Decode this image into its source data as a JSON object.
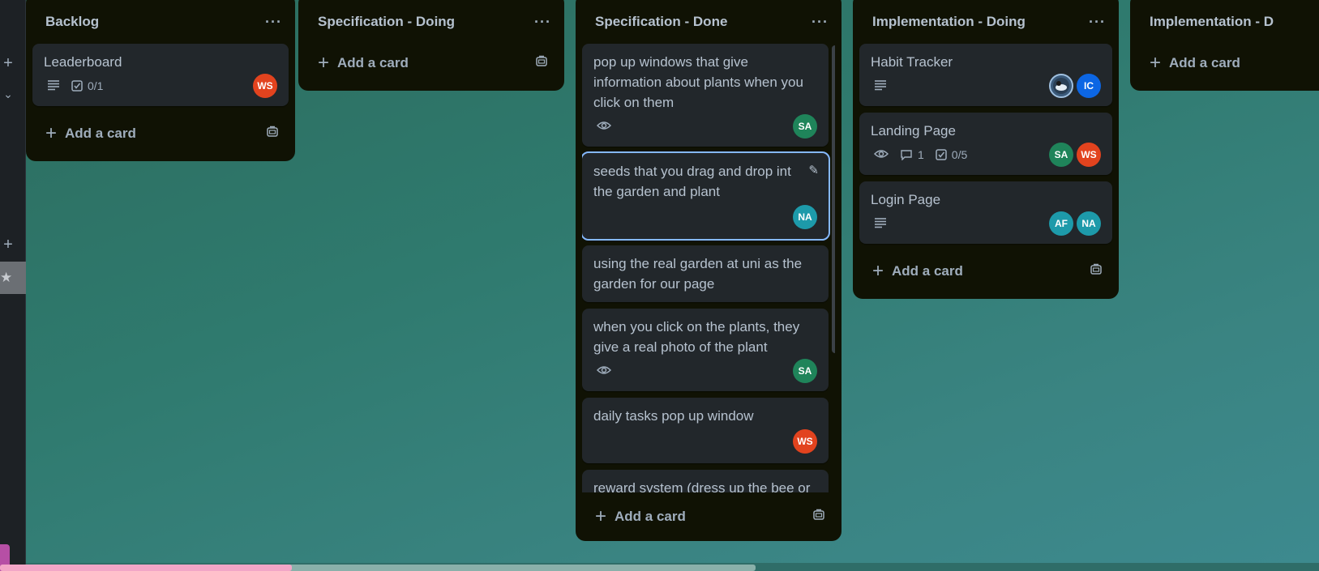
{
  "lists": [
    {
      "title": "Backlog",
      "cards": [
        {
          "title": "Leaderboard",
          "checklist": "0/1",
          "avatars": [
            {
              "initials": "WS",
              "color": "#e2431e"
            }
          ]
        }
      ],
      "add_label": "Add a card"
    },
    {
      "title": "Specification - Doing",
      "cards": [],
      "add_label": "Add a card"
    },
    {
      "title": "Specification - Done",
      "cards": [
        {
          "title": "pop up windows that give information about plants when you click on them",
          "avatars": [
            {
              "initials": "SA",
              "color": "#1f845a"
            }
          ]
        },
        {
          "title": "seeds that you drag and drop int the garden and plant",
          "avatars": [
            {
              "initials": "NA",
              "color": "#1d9aaa"
            }
          ]
        },
        {
          "title": "using the real garden at uni as the garden for our page"
        },
        {
          "title": "when you click on the plants, they give a real photo of the plant",
          "avatars": [
            {
              "initials": "SA",
              "color": "#1f845a"
            }
          ]
        },
        {
          "title": "daily tasks pop up window",
          "avatars": [
            {
              "initials": "WS",
              "color": "#e2431e"
            }
          ]
        },
        {
          "title": "reward system (dress up the bee or"
        }
      ],
      "add_label": "Add a card"
    },
    {
      "title": "Implementation - Doing",
      "cards": [
        {
          "title": "Habit Tracker",
          "avatars": [
            {
              "initials": "",
              "color": "#3b5a7a"
            },
            {
              "initials": "IC",
              "color": "#0c66e4"
            }
          ]
        },
        {
          "title": "Landing Page",
          "comments": "1",
          "checklist": "0/5",
          "avatars": [
            {
              "initials": "SA",
              "color": "#1f845a"
            },
            {
              "initials": "WS",
              "color": "#e2431e"
            }
          ]
        },
        {
          "title": "Login Page",
          "avatars": [
            {
              "initials": "AF",
              "color": "#1d9aaa"
            },
            {
              "initials": "NA",
              "color": "#1d9aaa"
            }
          ]
        }
      ],
      "add_label": "Add a card"
    },
    {
      "title": "Implementation - D",
      "cards": [],
      "add_label": "Add a card"
    }
  ]
}
